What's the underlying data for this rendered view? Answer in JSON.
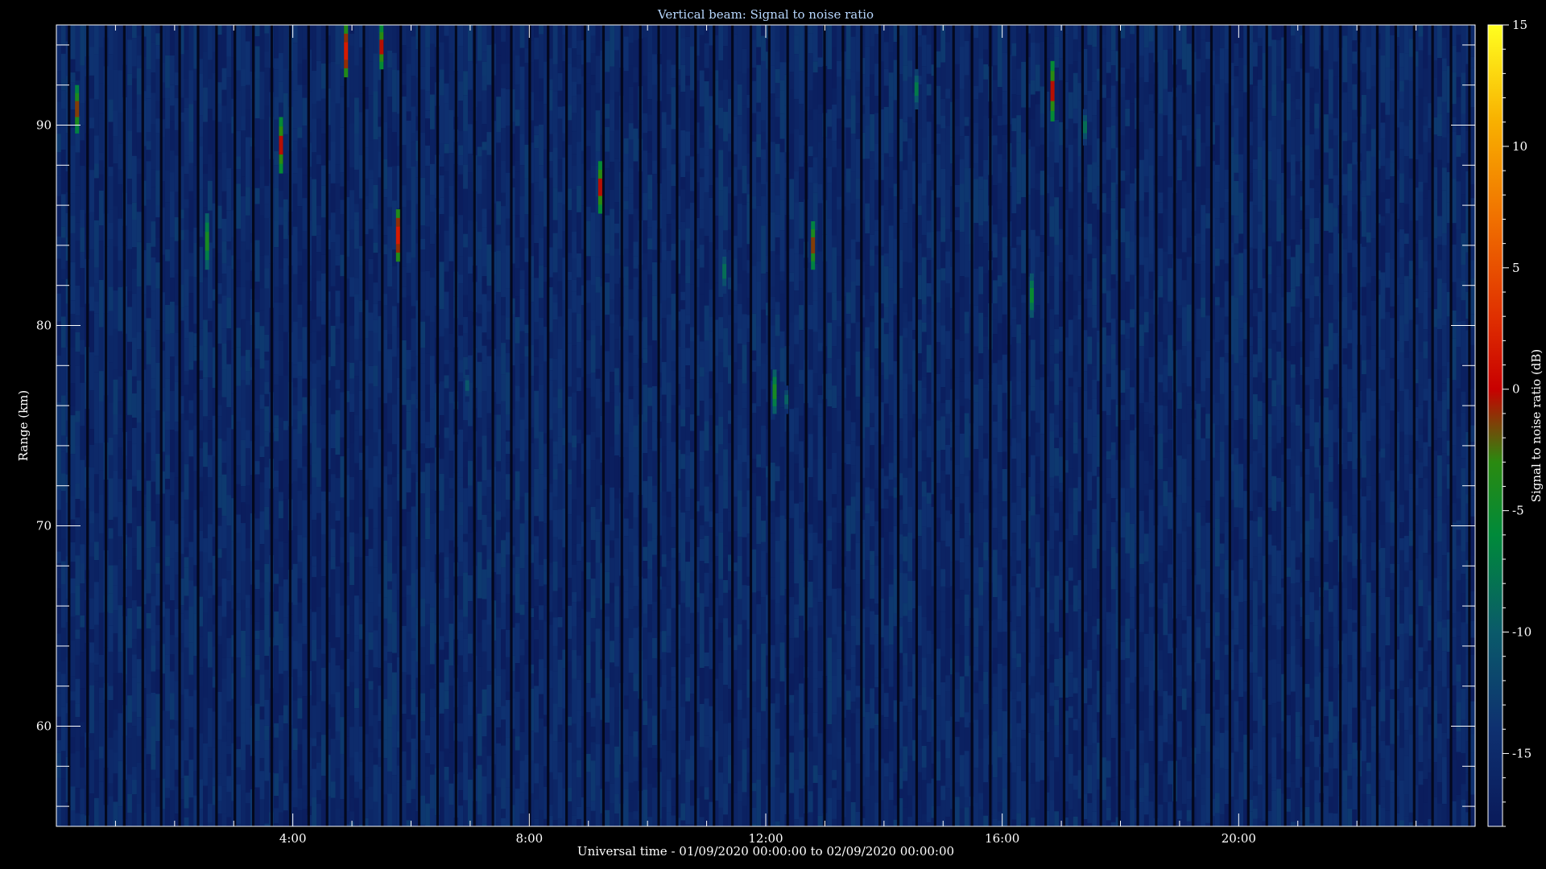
{
  "chart_data": {
    "type": "heatmap",
    "title": "Vertical beam: Signal to noise ratio",
    "xlabel": "Universal time - 01/09/2020 00:00:00 to 02/09/2020 00:00:00",
    "ylabel": "Range (km)",
    "colorbar_label": "Signal to noise ratio (dB)",
    "x_range_hours": [
      0,
      24
    ],
    "y_range_km": [
      55,
      95
    ],
    "x_ticks": [
      {
        "hour": 4,
        "label": "4:00"
      },
      {
        "hour": 8,
        "label": "8:00"
      },
      {
        "hour": 12,
        "label": "12:00"
      },
      {
        "hour": 16,
        "label": "16:00"
      },
      {
        "hour": 20,
        "label": "20:00"
      }
    ],
    "y_ticks": [
      {
        "km": 60,
        "label": "60"
      },
      {
        "km": 70,
        "label": "70"
      },
      {
        "km": 80,
        "label": "80"
      },
      {
        "km": 90,
        "label": "90"
      }
    ],
    "colorbar_range_db": [
      -18,
      15
    ],
    "colorbar_ticks": [
      {
        "db": 15,
        "label": "15"
      },
      {
        "db": 10,
        "label": "10"
      },
      {
        "db": 5,
        "label": "5"
      },
      {
        "db": 0,
        "label": "0"
      },
      {
        "db": -5,
        "label": "-5"
      },
      {
        "db": -10,
        "label": "-10"
      },
      {
        "db": -15,
        "label": "-15"
      }
    ],
    "colormap": [
      {
        "db": -18,
        "color": "#0a1a5a"
      },
      {
        "db": -14,
        "color": "#0e3070"
      },
      {
        "db": -10,
        "color": "#0a5a6a"
      },
      {
        "db": -6,
        "color": "#008a3a"
      },
      {
        "db": -3,
        "color": "#2a8a10"
      },
      {
        "db": 0,
        "color": "#c80000"
      },
      {
        "db": 3,
        "color": "#e03000"
      },
      {
        "db": 7,
        "color": "#f07000"
      },
      {
        "db": 11,
        "color": "#f8b000"
      },
      {
        "db": 15,
        "color": "#ffff20"
      }
    ],
    "background_level_db": -16,
    "echoes": [
      {
        "hour": 0.35,
        "km_bottom": 89.6,
        "km_top": 92.0,
        "peak_db": 0
      },
      {
        "hour": 2.55,
        "km_bottom": 82.8,
        "km_top": 85.6,
        "peak_db": -3
      },
      {
        "hour": 3.8,
        "km_bottom": 87.6,
        "km_top": 90.4,
        "peak_db": 1
      },
      {
        "hour": 4.9,
        "km_bottom": 92.4,
        "km_top": 95.0,
        "peak_db": 3
      },
      {
        "hour": 5.5,
        "km_bottom": 92.8,
        "km_top": 95.0,
        "peak_db": 1
      },
      {
        "hour": 5.78,
        "km_bottom": 83.2,
        "km_top": 85.8,
        "peak_db": 3
      },
      {
        "hour": 6.95,
        "km_bottom": 76.2,
        "km_top": 77.8,
        "peak_db": -9
      },
      {
        "hour": 9.2,
        "km_bottom": 85.6,
        "km_top": 88.2,
        "peak_db": 1
      },
      {
        "hour": 11.3,
        "km_bottom": 81.6,
        "km_top": 83.8,
        "peak_db": -7
      },
      {
        "hour": 12.15,
        "km_bottom": 75.6,
        "km_top": 77.8,
        "peak_db": -3
      },
      {
        "hour": 12.35,
        "km_bottom": 75.6,
        "km_top": 77.0,
        "peak_db": -8
      },
      {
        "hour": 12.8,
        "km_bottom": 82.8,
        "km_top": 85.2,
        "peak_db": 0
      },
      {
        "hour": 14.55,
        "km_bottom": 90.8,
        "km_top": 92.8,
        "peak_db": -6
      },
      {
        "hour": 16.5,
        "km_bottom": 80.4,
        "km_top": 82.6,
        "peak_db": -4
      },
      {
        "hour": 16.85,
        "km_bottom": 90.2,
        "km_top": 93.2,
        "peak_db": 1
      },
      {
        "hour": 17.4,
        "km_bottom": 89.0,
        "km_top": 90.8,
        "peak_db": -7
      }
    ]
  }
}
